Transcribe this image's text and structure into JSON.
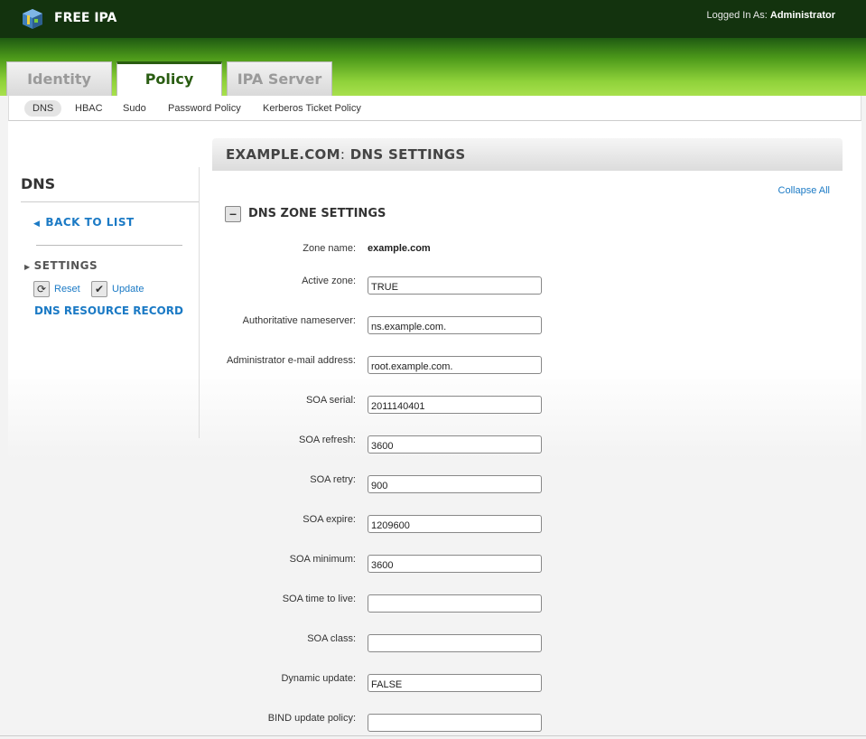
{
  "header": {
    "brand": "FREE IPA",
    "logged_in_prefix": "Logged In As:",
    "user": "Administrator"
  },
  "tabs": [
    {
      "label": "Identity",
      "active": false
    },
    {
      "label": "Policy",
      "active": true
    },
    {
      "label": "IPA Server",
      "active": false
    }
  ],
  "subnav": [
    {
      "label": "DNS",
      "active": true
    },
    {
      "label": "HBAC",
      "active": false
    },
    {
      "label": "Sudo",
      "active": false
    },
    {
      "label": "Password Policy",
      "active": false
    },
    {
      "label": "Kerberos Ticket Policy",
      "active": false
    }
  ],
  "sidebar": {
    "title": "DNS",
    "back_link": "BACK TO LIST",
    "settings": "SETTINGS",
    "reset": "Reset",
    "update": "Update",
    "dns_resource_record": "DNS RESOURCE RECORD"
  },
  "main": {
    "title_zone": "EXAMPLE.COM",
    "title_sep": ":",
    "title_rest": "DNS SETTINGS",
    "collapse_all": "Collapse All",
    "section_title": "DNS ZONE SETTINGS",
    "zone_name_label": "Zone name:",
    "zone_name_value": "example.com",
    "fields": [
      {
        "label": "Active zone:",
        "value": "TRUE"
      },
      {
        "label": "Authoritative nameserver:",
        "value": "ns.example.com."
      },
      {
        "label": "Administrator e-mail address:",
        "value": "root.example.com."
      },
      {
        "label": "SOA serial:",
        "value": "2011140401"
      },
      {
        "label": "SOA refresh:",
        "value": "3600"
      },
      {
        "label": "SOA retry:",
        "value": "900"
      },
      {
        "label": "SOA expire:",
        "value": "1209600"
      },
      {
        "label": "SOA minimum:",
        "value": "3600"
      },
      {
        "label": "SOA time to live:",
        "value": ""
      },
      {
        "label": "SOA class:",
        "value": ""
      },
      {
        "label": "Dynamic update:",
        "value": "FALSE"
      },
      {
        "label": "BIND update policy:",
        "value": ""
      }
    ]
  },
  "colors": {
    "topbar": "#13330e",
    "accent_green": "#2a5d12",
    "link_blue": "#1b7ac5"
  }
}
